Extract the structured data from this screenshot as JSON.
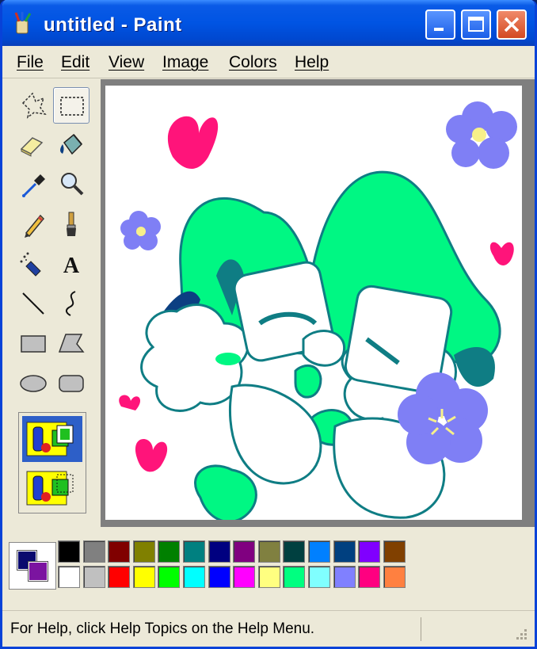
{
  "window": {
    "title": "untitled - Paint",
    "icon": "paint-icon"
  },
  "title_buttons": [
    "minimize-icon",
    "maximize-icon",
    "close-icon"
  ],
  "menu": [
    {
      "label": "File"
    },
    {
      "label": "Edit"
    },
    {
      "label": "View"
    },
    {
      "label": "Image"
    },
    {
      "label": "Colors"
    },
    {
      "label": "Help"
    }
  ],
  "tools": [
    {
      "icon": "free-form-select-icon",
      "selected": false
    },
    {
      "icon": "select-icon",
      "selected": true
    },
    {
      "icon": "eraser-icon",
      "selected": false
    },
    {
      "icon": "fill-with-color-icon",
      "selected": false
    },
    {
      "icon": "pick-color-icon",
      "selected": false
    },
    {
      "icon": "magnifier-icon",
      "selected": false
    },
    {
      "icon": "pencil-icon",
      "selected": false
    },
    {
      "icon": "brush-icon",
      "selected": false
    },
    {
      "icon": "airbrush-icon",
      "selected": false
    },
    {
      "icon": "text-icon",
      "selected": false
    },
    {
      "icon": "line-icon",
      "selected": false
    },
    {
      "icon": "curve-icon",
      "selected": false
    },
    {
      "icon": "rectangle-icon",
      "selected": false
    },
    {
      "icon": "polygon-icon",
      "selected": false
    },
    {
      "icon": "ellipse-icon",
      "selected": false
    },
    {
      "icon": "rounded-rectangle-icon",
      "selected": false
    }
  ],
  "selection_options": [
    {
      "icon": "opaque-selection-icon",
      "selected": true
    },
    {
      "icon": "transparent-selection-icon",
      "selected": false
    }
  ],
  "palette": {
    "foreground": "#0a0a6e",
    "background": "#7b14a0",
    "top_row": [
      "#000000",
      "#808080",
      "#800000",
      "#808000",
      "#008000",
      "#008080",
      "#000080",
      "#800080",
      "#808040",
      "#004040",
      "#0080ff",
      "#004080",
      "#8000ff",
      "#804000"
    ],
    "bottom_row": [
      "#ffffff",
      "#c0c0c0",
      "#ff0000",
      "#ffff00",
      "#00ff00",
      "#00ffff",
      "#0000ff",
      "#ff00ff",
      "#ffff80",
      "#00ff80",
      "#80ffff",
      "#8080ff",
      "#ff0080",
      "#ff8040"
    ]
  },
  "canvas": {
    "colors": {
      "mint": "#00f783",
      "teal": "#0f7d84",
      "navy": "#0c3f82",
      "pink": "#ff147a",
      "lavender": "#7f7ff5",
      "yellow": "#f7f08a"
    }
  },
  "status": {
    "text": "For Help, click Help Topics on the Help Menu."
  }
}
